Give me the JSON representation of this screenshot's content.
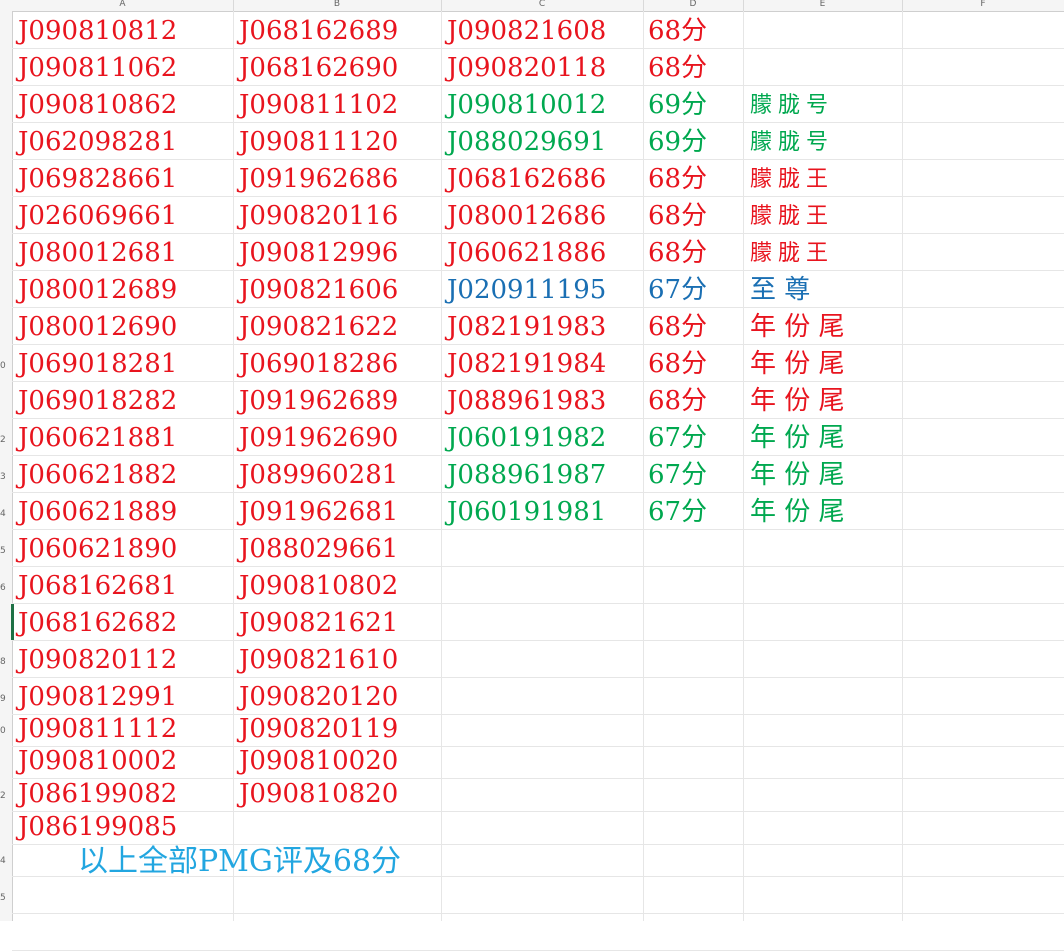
{
  "colors": {
    "red": "#e8141e",
    "green": "#00a84f",
    "blue": "#1a6fb3",
    "cyan": "#22a6e0"
  },
  "columns": [
    "A",
    "B",
    "C",
    "D",
    "E",
    "F"
  ],
  "row_numbers": [
    "",
    "",
    "",
    "",
    "",
    "",
    "",
    "",
    "",
    "0",
    "",
    "2",
    "3",
    "4",
    "5",
    "6",
    "",
    "8",
    "9",
    "0",
    "",
    "2",
    "",
    "4",
    "5"
  ],
  "col_a": [
    "J090810812",
    "J090811062",
    "J090810862",
    "J062098281",
    "J069828661",
    "J026069661",
    "J080012681",
    "J080012689",
    "J080012690",
    "J069018281",
    "J069018282",
    "J060621881",
    "J060621882",
    "J060621889",
    "J060621890",
    "J068162681",
    "J068162682",
    "J090820112",
    "J090812991",
    "J090811112",
    "J090810002",
    "J086199082",
    "J086199085"
  ],
  "col_b": [
    "J068162689",
    "J068162690",
    "J090811102",
    "J090811120",
    "J091962686",
    "J090820116",
    "J090812996",
    "J090821606",
    "J090821622",
    "J069018286",
    "J091962689",
    "J091962690",
    "J089960281",
    "J091962681",
    "J088029661",
    "J090810802",
    "J090821621",
    "J090821610",
    "J090820120",
    "J090820119",
    "J090810020",
    "J090810820"
  ],
  "col_c": [
    {
      "text": "J090821608",
      "color": "red"
    },
    {
      "text": "J090820118",
      "color": "red"
    },
    {
      "text": "J090810012",
      "color": "green"
    },
    {
      "text": "J088029691",
      "color": "green"
    },
    {
      "text": "J068162686",
      "color": "red"
    },
    {
      "text": "J080012686",
      "color": "red"
    },
    {
      "text": "J060621886",
      "color": "red"
    },
    {
      "text": "J020911195",
      "color": "blue"
    },
    {
      "text": "J082191983",
      "color": "red"
    },
    {
      "text": "J082191984",
      "color": "red"
    },
    {
      "text": "J088961983",
      "color": "red"
    },
    {
      "text": "J060191982",
      "color": "green"
    },
    {
      "text": "J088961987",
      "color": "green"
    },
    {
      "text": "J060191981",
      "color": "green"
    }
  ],
  "col_d": [
    {
      "text": "68分",
      "color": "red"
    },
    {
      "text": "68分",
      "color": "red"
    },
    {
      "text": "69分",
      "color": "green"
    },
    {
      "text": "69分",
      "color": "green"
    },
    {
      "text": "68分",
      "color": "red"
    },
    {
      "text": "68分",
      "color": "red"
    },
    {
      "text": "68分",
      "color": "red"
    },
    {
      "text": "67分",
      "color": "blue"
    },
    {
      "text": "68分",
      "color": "red"
    },
    {
      "text": "68分",
      "color": "red"
    },
    {
      "text": "68分",
      "color": "red"
    },
    {
      "text": "67分",
      "color": "green"
    },
    {
      "text": "67分",
      "color": "green"
    },
    {
      "text": "67分",
      "color": "green"
    }
  ],
  "col_e": [
    {
      "text": "",
      "color": "red",
      "size": "lg"
    },
    {
      "text": "",
      "color": "red",
      "size": "lg"
    },
    {
      "text": "朦胧号",
      "color": "green",
      "size": "sm"
    },
    {
      "text": "朦胧号",
      "color": "green",
      "size": "sm"
    },
    {
      "text": "朦胧王",
      "color": "red",
      "size": "sm"
    },
    {
      "text": "朦胧王",
      "color": "red",
      "size": "sm"
    },
    {
      "text": "朦胧王",
      "color": "red",
      "size": "sm"
    },
    {
      "text": "至 尊",
      "color": "blue",
      "size": "lg"
    },
    {
      "text": "年 份 尾",
      "color": "red",
      "size": "lg"
    },
    {
      "text": "年 份 尾",
      "color": "red",
      "size": "lg"
    },
    {
      "text": "年 份 尾",
      "color": "red",
      "size": "lg"
    },
    {
      "text": "年 份 尾",
      "color": "green",
      "size": "lg"
    },
    {
      "text": "年 份 尾",
      "color": "green",
      "size": "lg"
    },
    {
      "text": "年 份 尾",
      "color": "green",
      "size": "lg"
    }
  ],
  "note": {
    "text": "以上全部PMG评及68分",
    "color": "cyan"
  }
}
